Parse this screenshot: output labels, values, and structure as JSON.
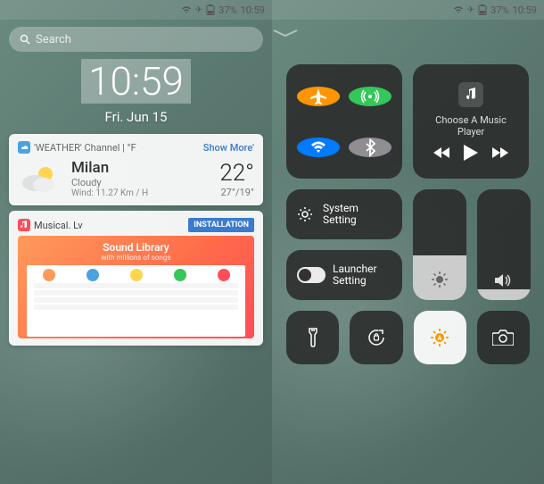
{
  "statusbar": {
    "battery": "37%",
    "time": "10:59"
  },
  "left": {
    "search_placeholder": "Search",
    "clock_time": "10:59",
    "clock_date": "Fri. Jun 15",
    "weather": {
      "channel_label": "'WEATHER' Channel | °F",
      "show_more": "Show More'",
      "city": "Milan",
      "condition": "Cloudy",
      "wind": "Wind: 11.27 Km / H",
      "temp": "22°",
      "range": "27°/19°"
    },
    "ad": {
      "title": "Musical. Lv",
      "install": "INSTALLATION",
      "preview_title": "Sound Library",
      "preview_sub": "with millions of songs"
    }
  },
  "right": {
    "music_label": "Choose A Music Player",
    "system_setting": "System Setting",
    "launcher_setting": "Launcher Setting",
    "brightness_level": 40,
    "volume_level": 10
  }
}
